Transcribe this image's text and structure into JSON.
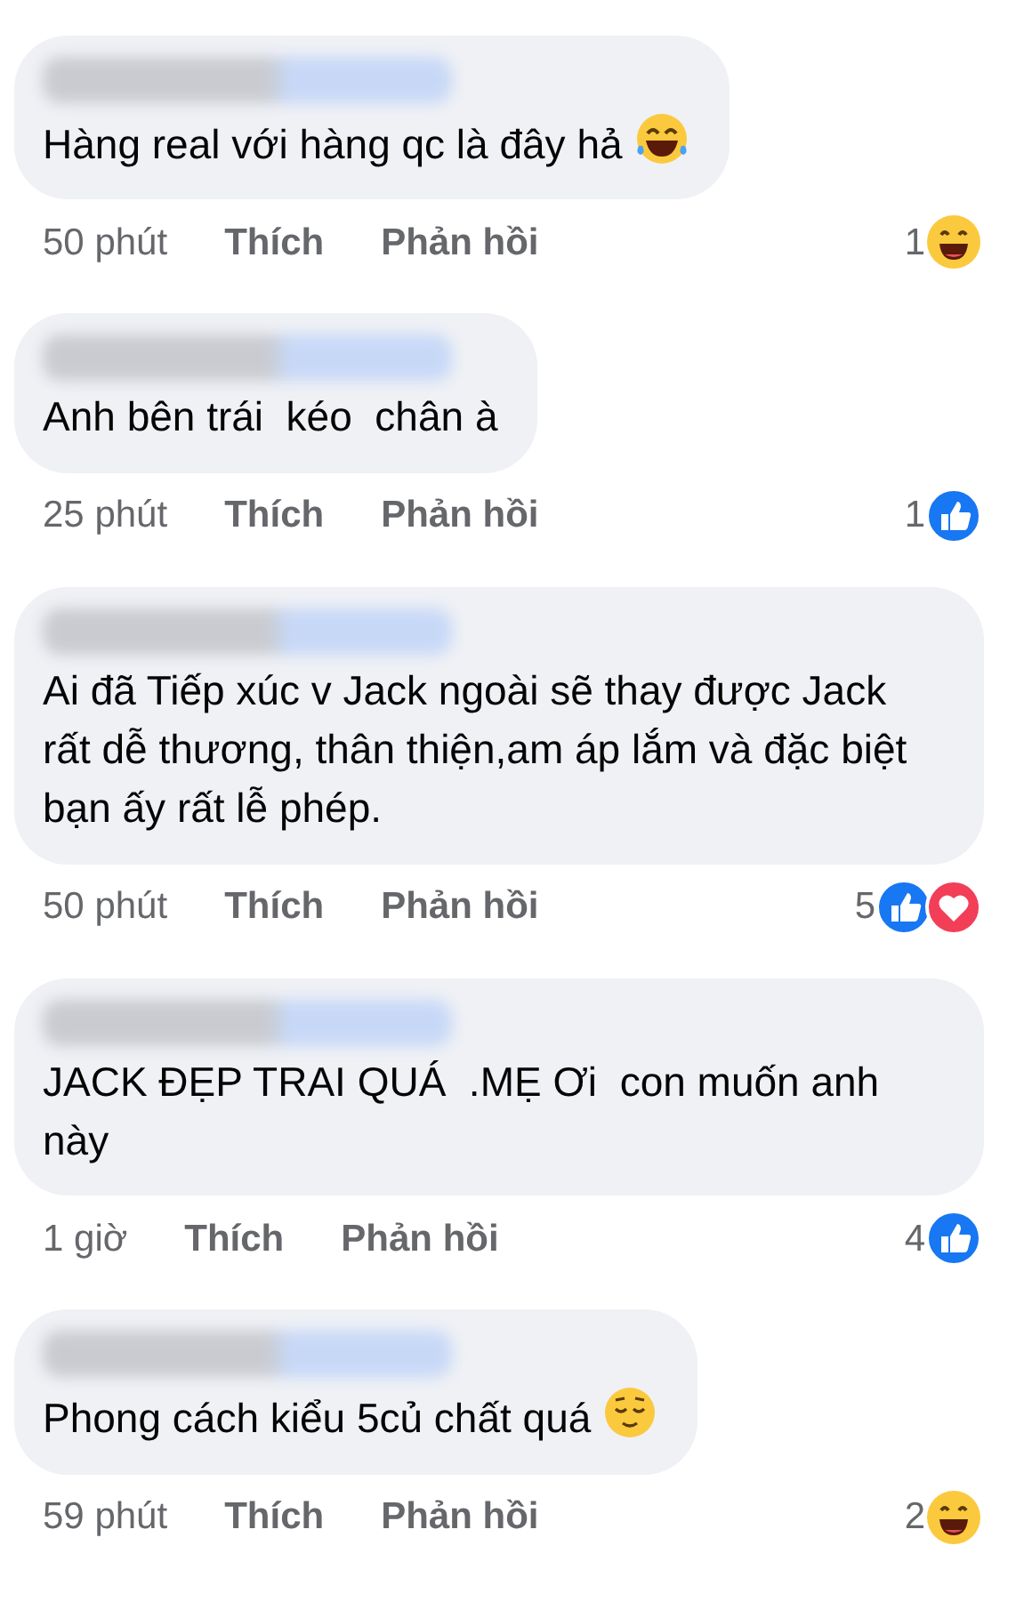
{
  "comments": [
    {
      "text": "Hàng real với hàng qc là đây hả",
      "emoji": {
        "kind": "tears-of-joy"
      },
      "time": "50 phút",
      "like": "Thích",
      "reply": "Phản hồi",
      "count": "1",
      "reactions": [
        {
          "kind": "haha"
        }
      ]
    },
    {
      "text": "Anh bên trái  kéo  chân à",
      "time": "25 phút",
      "like": "Thích",
      "reply": "Phản hồi",
      "count": "1",
      "reactions": [
        {
          "kind": "like"
        }
      ]
    },
    {
      "text": "Ai đã Tiếp xúc v Jack ngoài sẽ thay được Jack rất dễ thương, thân thiện,am áp lắm và đặc biệt bạn ấy rất lễ phép.",
      "time": "50 phút",
      "like": "Thích",
      "reply": "Phản hồi",
      "count": "5",
      "reactions": [
        {
          "kind": "like"
        },
        {
          "kind": "love"
        }
      ]
    },
    {
      "text": "JACK ĐẸP TRAI QUÁ  .MẸ Ơi  con muốn anh này",
      "time": "1 giờ",
      "like": "Thích",
      "reply": "Phản hồi",
      "count": "4",
      "reactions": [
        {
          "kind": "like"
        }
      ]
    },
    {
      "text": "Phong cách kiểu 5củ chất quá",
      "emoji": {
        "kind": "relieved"
      },
      "time": "59 phút",
      "like": "Thích",
      "reply": "Phản hồi",
      "count": "2",
      "reactions": [
        {
          "kind": "haha"
        }
      ]
    }
  ]
}
